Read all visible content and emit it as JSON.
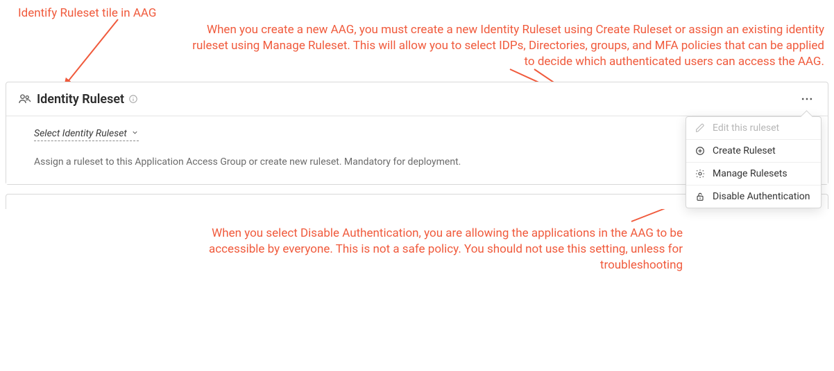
{
  "annotations": {
    "top_left": "Identify Ruleset tile in AAG",
    "top_right": "When you create a new AAG, you must create a new  Identity Ruleset using Create Ruleset  or assign an existing  identity  ruleset using Manage Ruleset. This will allow you to select  IDPs, Directories, groups, and MFA policies that can be applied  to decide which  authenticated users can access the AAG.",
    "bottom": "When you select Disable Authentication,  you are allowing  the applications in the AAG to be accessible by everyone. This is not a safe policy. You should not use this setting, unless for troubleshooting"
  },
  "panel": {
    "title": "Identity Ruleset",
    "select_label": "Select Identity Ruleset",
    "helper": "Assign a ruleset to this Application Access Group or create new ruleset. Mandatory for deployment."
  },
  "menu": {
    "edit": "Edit this ruleset",
    "create": "Create Ruleset",
    "manage": "Manage Rulesets",
    "disable": "Disable Authentication"
  },
  "colors": {
    "annotation": "#f05a3c"
  }
}
